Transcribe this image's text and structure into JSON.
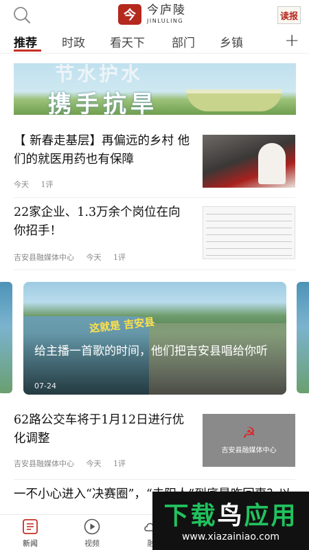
{
  "header": {
    "search_icon": "search-icon",
    "logo_mark": "今",
    "logo_name": "今庐陵",
    "logo_en": "JINLULING",
    "read_label": "读报"
  },
  "tabs": {
    "items": [
      {
        "label": "推荐",
        "active": true
      },
      {
        "label": "时政"
      },
      {
        "label": "看天下"
      },
      {
        "label": "部门"
      },
      {
        "label": "乡镇"
      }
    ],
    "add_icon": "plus-icon"
  },
  "banner": {
    "line1": "节水护水",
    "line2": "携手抗旱"
  },
  "news": [
    {
      "title": "【 新春走基层】再偏远的乡村 他们的就医用药也有保障",
      "source": "",
      "time": "今天",
      "comments": "1评"
    },
    {
      "title": "22家企业、1.3万余个岗位在向你招手！",
      "source": "吉安县融媒体中心",
      "time": "今天",
      "comments": "1评"
    },
    {
      "title": "62路公交车将于1月12日进行优化调整",
      "source": "吉安县融媒体中心",
      "time": "今天",
      "comments": "1评",
      "thumb_text": "吉安县融媒体中心"
    },
    {
      "title": "一不小心进入“决赛圈”，“去阳人”到底是咋回事？以"
    }
  ],
  "video": {
    "stamp": "这就是 吉安县",
    "caption": "给主播一首歌的时间，他们把吉安县唱给你听",
    "date": "07-24"
  },
  "bottom_nav": {
    "items": [
      {
        "label": "新闻",
        "icon": "news-icon"
      },
      {
        "label": "视频",
        "icon": "video-play-icon"
      },
      {
        "label": "融",
        "icon": "cloud-icon"
      }
    ]
  },
  "watermark": {
    "brand_a": "下载",
    "brand_b": "鸟",
    "brand_c": "应用",
    "url": "www.xiazainiao.com"
  }
}
